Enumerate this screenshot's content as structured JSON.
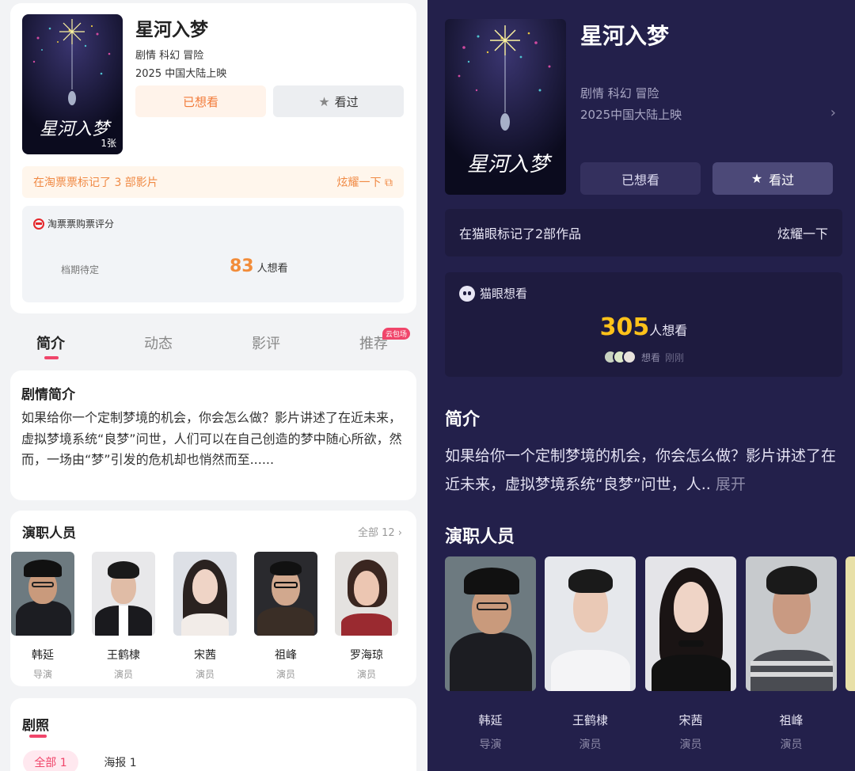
{
  "left": {
    "movie": {
      "title": "星河入梦",
      "genres": "剧情 科幻 冒险",
      "release": "2025 中国大陆上映",
      "poster_count": "1张",
      "want_button": "已想看",
      "seen_button": "看过"
    },
    "marked": {
      "text": "在淘票票标记了 3 部影片",
      "action": "炫耀一下"
    },
    "rating": {
      "heading": "淘票票购票评分",
      "status": "档期待定",
      "want_count": "83",
      "want_suffix": "人想看"
    },
    "tabs": [
      {
        "label": "简介"
      },
      {
        "label": "动态"
      },
      {
        "label": "影评"
      },
      {
        "label": "推荐",
        "badge": "云包场"
      }
    ],
    "synopsis": {
      "title": "剧情简介",
      "text": "如果给你一个定制梦境的机会，你会怎么做？影片讲述了在近未来，虚拟梦境系统“良梦”问世，人们可以在自己创造的梦中随心所欲，然而，一场由“梦”引发的危机却也悄然而至......"
    },
    "cast": {
      "title": "演职人员",
      "all_label": "全部 12 ›",
      "people": [
        {
          "name": "韩延",
          "role": "导演"
        },
        {
          "name": "王鹤棣",
          "role": "演员"
        },
        {
          "name": "宋茜",
          "role": "演员"
        },
        {
          "name": "祖峰",
          "role": "演员"
        },
        {
          "name": "罗海琼",
          "role": "演员"
        }
      ]
    },
    "stills": {
      "title": "剧照",
      "chips": [
        "全部 1",
        "海报 1"
      ]
    }
  },
  "right": {
    "movie": {
      "title": "星河入梦",
      "genres": "剧情 科幻 冒险",
      "release": "2025中国大陆上映",
      "want_button": "已想看",
      "seen_button": "看过"
    },
    "marked": {
      "text": "在猫眼标记了2部作品",
      "action": "炫耀一下"
    },
    "want": {
      "heading": "猫眼想看",
      "count": "305",
      "suffix": "人想看",
      "recent_label": "想看",
      "recent_time": "刚刚"
    },
    "intro": {
      "title": "简介",
      "text": "如果给你一个定制梦境的机会，你会怎么做？影片讲述了在近未来，虚拟梦境系统“良梦”问世，人..",
      "expand": "展开"
    },
    "cast": {
      "title": "演职人员",
      "people": [
        {
          "name": "韩延",
          "role": "导演"
        },
        {
          "name": "王鹤棣",
          "role": "演员"
        },
        {
          "name": "宋茜",
          "role": "演员"
        },
        {
          "name": "祖峰",
          "role": "演员"
        }
      ]
    }
  },
  "colors": {
    "accent_pink": "#f0456a",
    "accent_orange": "#f27b3a",
    "dark_bg": "#23204b",
    "gold": "#ffc21a"
  }
}
